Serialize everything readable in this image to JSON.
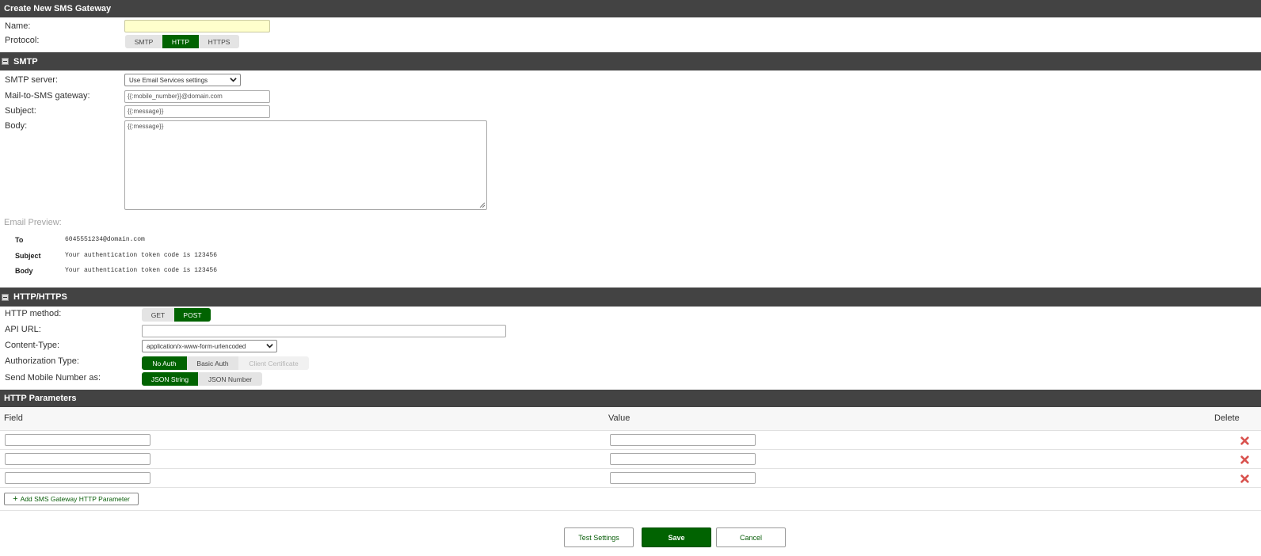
{
  "header": {
    "title": "Create New SMS Gateway"
  },
  "general": {
    "name_label": "Name:",
    "name_value": "",
    "protocol_label": "Protocol:",
    "protocol_options": [
      "SMTP",
      "HTTP",
      "HTTPS"
    ],
    "protocol_selected": "HTTP"
  },
  "smtp": {
    "section_title": "SMTP",
    "server_label": "SMTP server:",
    "server_value": "Use Email Services settings",
    "gateway_label": "Mail-to-SMS gateway:",
    "gateway_value": "{{:mobile_number}}@domain.com",
    "subject_label": "Subject:",
    "subject_value": "{{:message}}",
    "body_label": "Body:",
    "body_value": "{{:message}}",
    "preview_label": "Email Preview:",
    "preview": {
      "to_key": "To",
      "to_value": "6045551234@domain.com",
      "subject_key": "Subject",
      "subject_value": "Your authentication token code is 123456",
      "body_key": "Body",
      "body_value": "Your authentication token code is 123456"
    }
  },
  "http": {
    "section_title": "HTTP/HTTPS",
    "method_label": "HTTP method:",
    "method_options": [
      "GET",
      "POST"
    ],
    "method_selected": "POST",
    "api_url_label": "API URL:",
    "api_url_value": "",
    "content_type_label": "Content-Type:",
    "content_type_value": "application/x-www-form-urlencoded",
    "auth_label": "Authorization Type:",
    "auth_options": [
      "No Auth",
      "Basic Auth",
      "Client Certificate"
    ],
    "auth_selected": "No Auth",
    "mobile_label": "Send Mobile Number as:",
    "mobile_options": [
      "JSON String",
      "JSON Number"
    ],
    "mobile_selected": "JSON String"
  },
  "params": {
    "section_title": "HTTP Parameters",
    "col_field": "Field",
    "col_value": "Value",
    "col_delete": "Delete",
    "rows": [
      {
        "field": "",
        "value": ""
      },
      {
        "field": "",
        "value": ""
      },
      {
        "field": "",
        "value": ""
      }
    ],
    "add_label": "Add SMS Gateway HTTP Parameter"
  },
  "footer": {
    "test_label": "Test Settings",
    "save_label": "Save",
    "cancel_label": "Cancel"
  },
  "colors": {
    "header_bg": "#434343",
    "accent_green": "#016301",
    "delete_red": "#d9534f",
    "name_field_bg": "#ffffcc"
  }
}
